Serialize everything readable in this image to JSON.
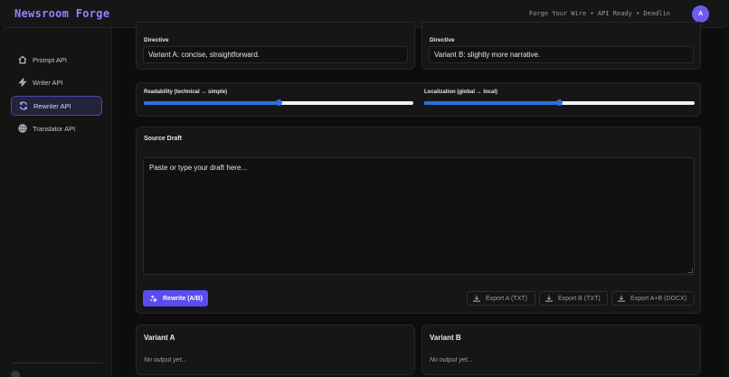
{
  "header": {
    "brand": "Newsroom Forge",
    "status": "Forge Your Wire • API Ready • Deadlin",
    "avatar_initial": "A"
  },
  "sidebar": {
    "items": [
      {
        "label": "Prompt API",
        "icon": "home-icon",
        "active": false
      },
      {
        "label": "Writer API",
        "icon": "bolt-icon",
        "active": false
      },
      {
        "label": "Rewriter API",
        "icon": "refresh-icon",
        "active": true
      },
      {
        "label": "Translator API",
        "icon": "globe-icon",
        "active": false
      }
    ]
  },
  "directives": {
    "a": {
      "label": "Directive",
      "value": "Variant A: concise, straightforward."
    },
    "b": {
      "label": "Directive",
      "value": "Variant B: slightly more narrative."
    }
  },
  "sliders": {
    "readability": {
      "label": "Readability (technical ↔ simple)",
      "value": 0.5
    },
    "localization": {
      "label": "Localization (global ↔ local)",
      "value": 0.5
    }
  },
  "source": {
    "label": "Source Draft",
    "placeholder": "Paste or type your draft here..."
  },
  "actions": {
    "rewrite": "Rewrite (A/B)",
    "export_a": "Export A (TXT)",
    "export_b": "Export B (TXT)",
    "export_ab": "Export A+B (DOCX)"
  },
  "outputs": {
    "a": {
      "title": "Variant A",
      "empty": "No output yet..."
    },
    "b": {
      "title": "Variant B",
      "empty": "No output yet..."
    }
  },
  "colors": {
    "accent": "#5b4cf0",
    "slider_fill": "#2f6fe0",
    "brand": "#8e86ff"
  }
}
